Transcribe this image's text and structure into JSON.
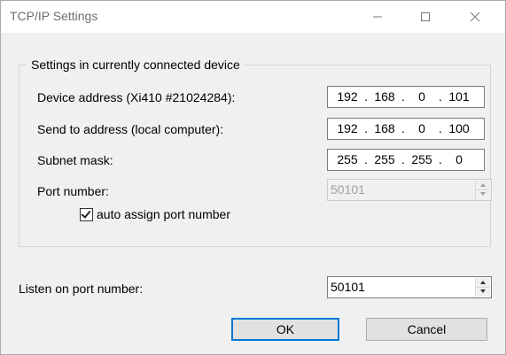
{
  "window": {
    "title": "TCP/IP Settings",
    "minimize_icon": "minimize-icon",
    "maximize_icon": "maximize-icon",
    "close_icon": "close-icon"
  },
  "group": {
    "legend": "Settings in currently connected device",
    "device_address": {
      "label": "Device address (Xi410 #21024284):",
      "octets": [
        "192",
        "168",
        "0",
        "101"
      ]
    },
    "send_to_address": {
      "label": "Send to address (local computer):",
      "octets": [
        "192",
        "168",
        "0",
        "100"
      ]
    },
    "subnet_mask": {
      "label": "Subnet mask:",
      "octets": [
        "255",
        "255",
        "255",
        "0"
      ]
    },
    "port_number": {
      "label": "Port number:",
      "value": "50101",
      "enabled": false
    },
    "auto_assign": {
      "label": "auto assign port number",
      "checked": true
    }
  },
  "listen_port": {
    "label": "Listen on port number:",
    "value": "50101"
  },
  "buttons": {
    "ok": "OK",
    "cancel": "Cancel"
  }
}
